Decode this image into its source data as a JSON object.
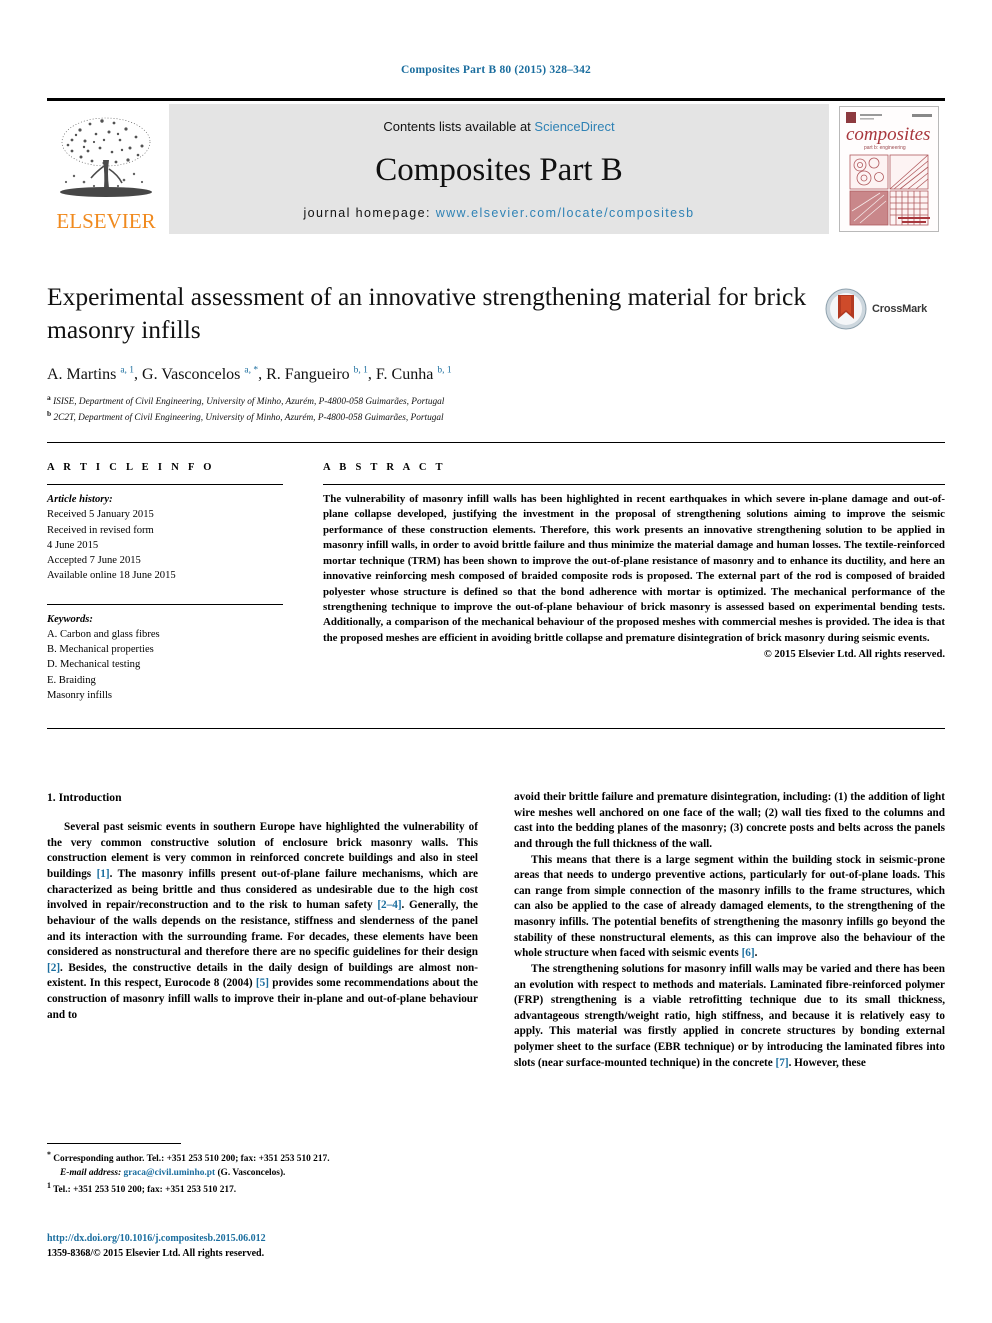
{
  "running_head": "Composites Part B 80 (2015) 328–342",
  "masthead": {
    "contents_prefix": "Contents lists available at ",
    "sciencedirect": "ScienceDirect",
    "journal_name": "Composites Part B",
    "homepage_prefix": "journal homepage: ",
    "homepage_url": "www.elsevier.com/locate/compositesb",
    "publisher": "ELSEVIER",
    "cover_title": "composites",
    "cover_subtitle": "part b: engineering",
    "accent_blue": "#2f82b5",
    "elsevier_orange": "#F08A1E",
    "band_gray": "#e4e4e4"
  },
  "article": {
    "title": "Experimental assessment of an innovative strengthening material for brick masonry infills",
    "crossmark_label": "CrossMark",
    "authors": [
      {
        "name": "A. Martins",
        "marks": "a, 1"
      },
      {
        "name": "G. Vasconcelos",
        "marks": "a, *"
      },
      {
        "name": "R. Fangueiro",
        "marks": "b, 1"
      },
      {
        "name": "F. Cunha",
        "marks": "b, 1"
      }
    ],
    "affiliations": [
      {
        "mark": "a",
        "text": "ISISE, Department of Civil Engineering, University of Minho, Azurém, P-4800-058 Guimarães, Portugal"
      },
      {
        "mark": "b",
        "text": "2C2T, Department of Civil Engineering, University of Minho, Azurém, P-4800-058 Guimarães, Portugal"
      }
    ]
  },
  "info": {
    "heading": "A R T I C L E   I N F O",
    "history_label": "Article history:",
    "history": [
      "Received 5 January 2015",
      "Received in revised form",
      "4 June 2015",
      "Accepted 7 June 2015",
      "Available online 18 June 2015"
    ],
    "keywords_label": "Keywords:",
    "keywords": [
      "A. Carbon and glass fibres",
      "B. Mechanical properties",
      "D. Mechanical testing",
      "E. Braiding",
      "Masonry infills"
    ]
  },
  "abstract": {
    "heading": "A B S T R A C T",
    "text": "The vulnerability of masonry infill walls has been highlighted in recent earthquakes in which severe in-plane damage and out-of-plane collapse developed, justifying the investment in the proposal of strengthening solutions aiming to improve the seismic performance of these construction elements. Therefore, this work presents an innovative strengthening solution to be applied in masonry infill walls, in order to avoid brittle failure and thus minimize the material damage and human losses. The textile-reinforced mortar technique (TRM) has been shown to improve the out-of-plane resistance of masonry and to enhance its ductility, and here an innovative reinforcing mesh composed of braided composite rods is proposed. The external part of the rod is composed of braided polyester whose structure is defined so that the bond adherence with mortar is optimized. The mechanical performance of the strengthening technique to improve the out-of-plane behaviour of brick masonry is assessed based on experimental bending tests. Additionally, a comparison of the mechanical behaviour of the proposed meshes with commercial meshes is provided. The idea is that the proposed meshes are efficient in avoiding brittle collapse and premature disintegration of brick masonry during seismic events.",
    "copyright": "© 2015 Elsevier Ltd. All rights reserved."
  },
  "body": {
    "section_heading": "1. Introduction",
    "left_p1_a": "Several past seismic events in southern Europe have highlighted the vulnerability of the very common constructive solution of enclosure brick masonry walls. This construction element is very common in reinforced concrete buildings and also in steel buildings ",
    "left_ref1": "[1]",
    "left_p1_b": ". The masonry infills present out-of-plane failure mechanisms, which are characterized as being brittle and thus considered as undesirable due to the high cost involved in repair/reconstruction and to the risk to human safety ",
    "left_ref2": "[2–4]",
    "left_p1_c": ". Generally, the behaviour of the walls depends on the resistance, stiffness and slenderness of the panel and its interaction with the surrounding frame. For decades, these elements have been considered as nonstructural and therefore there are no specific guidelines for their design ",
    "left_ref3": "[2]",
    "left_p1_d": ". Besides, the constructive details in the daily design of buildings are almost non-existent. In this respect, Eurocode 8 (2004) ",
    "left_ref4": "[5]",
    "left_p1_e": " provides some recommendations about the construction of masonry infill walls to improve their in-plane and out-of-plane behaviour and to",
    "right_p1": "avoid their brittle failure and premature disintegration, including: (1) the addition of light wire meshes well anchored on one face of the wall; (2) wall ties fixed to the columns and cast into the bedding planes of the masonry; (3) concrete posts and belts across the panels and through the full thickness of the wall.",
    "right_p2_a": "This means that there is a large segment within the building stock in seismic-prone areas that needs to undergo preventive actions, particularly for out-of-plane loads. This can range from simple connection of the masonry infills to the frame structures, which can also be applied to the case of already damaged elements, to the strengthening of the masonry infills. The potential benefits of strengthening the masonry infills go beyond the stability of these nonstructural elements, as this can improve also the behaviour of the whole structure when faced with seismic events ",
    "right_ref6": "[6]",
    "right_p2_b": ".",
    "right_p3_a": "The strengthening solutions for masonry infill walls may be varied and there has been an evolution with respect to methods and materials. Laminated fibre-reinforced polymer (FRP) strengthening is a viable retrofitting technique due to its small thickness, advantageous strength/weight ratio, high stiffness, and because it is relatively easy to apply. This material was firstly applied in concrete structures by bonding external polymer sheet to the surface (EBR technique) or by introducing the laminated fibres into slots (near surface-mounted technique) in the concrete ",
    "right_ref7": "[7]",
    "right_p3_b": ". However, these"
  },
  "footnotes": {
    "corresponding": "Corresponding author. Tel.: +351 253 510 200; fax: +351 253 510 217.",
    "email_label": "E-mail address:",
    "email": "graca@civil.uminho.pt",
    "email_suffix": " (G. Vasconcelos).",
    "tel_note": "Tel.: +351 253 510 200; fax: +351 253 510 217.",
    "star": "*",
    "one": "1"
  },
  "doi": {
    "url": "http://dx.doi.org/10.1016/j.compositesb.2015.06.012",
    "issn_line": "1359-8368/© 2015 Elsevier Ltd. All rights reserved."
  }
}
